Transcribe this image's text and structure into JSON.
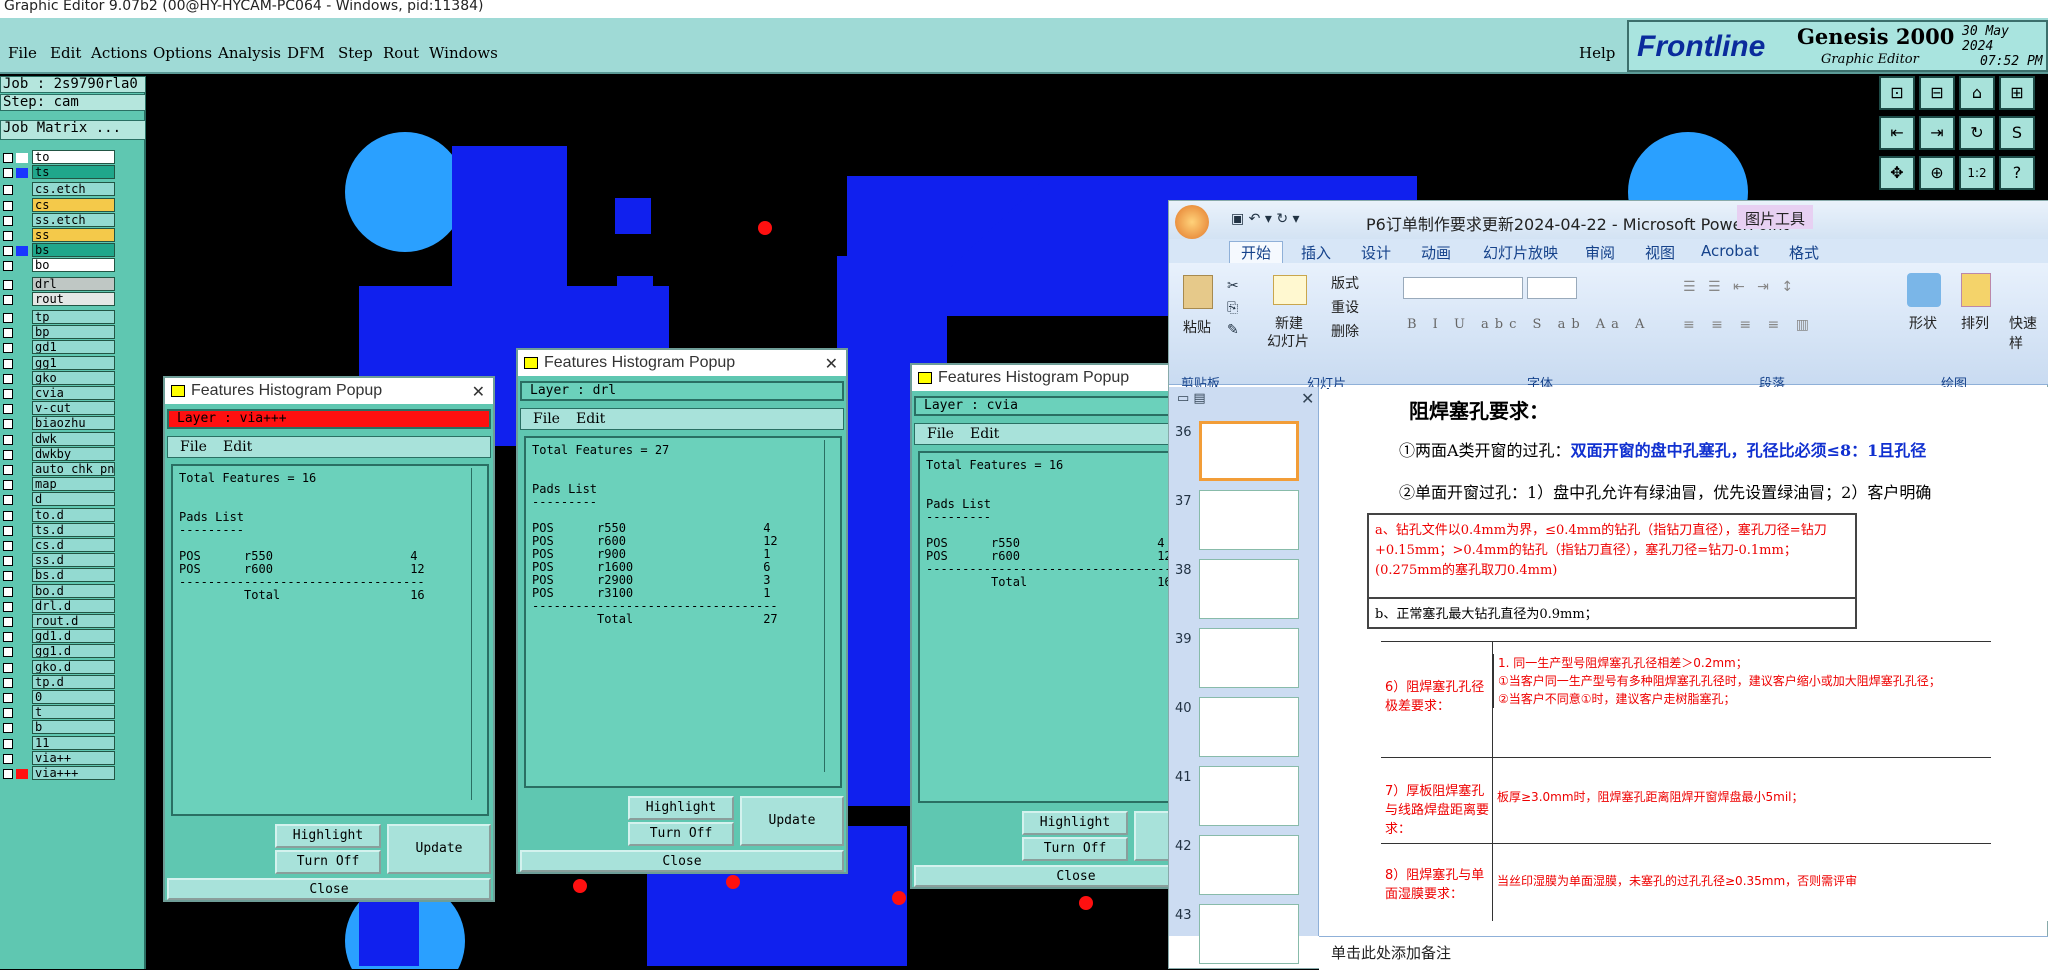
{
  "window": {
    "title": "Graphic Editor 9.07b2 (00@HY-HYCAM-PC064 - Windows, pid:11384)"
  },
  "menubar": {
    "items": [
      "File",
      "Edit",
      "Actions",
      "Options",
      "Analysis",
      "DFM",
      "Step",
      "Rout",
      "Windows"
    ],
    "help": "Help"
  },
  "brand": {
    "logo": "Frontline",
    "product": "Genesis 2000",
    "subtitle": "Graphic Editor",
    "date": "30 May 2024",
    "time": "07:52 PM"
  },
  "job": {
    "job": "Job : 2s9790rla0",
    "step": "Step: cam",
    "matrix": "Job Matrix ..."
  },
  "layers": [
    {
      "name": "to",
      "swatch": "#ffffff",
      "bg": "#ffffff"
    },
    {
      "name": "ts",
      "swatch": "#1a36ff",
      "bg": "#20a78b"
    },
    {
      "name": "cs.etch",
      "swatch": "",
      "bg": "#93dad1"
    },
    {
      "name": "cs",
      "swatch": "",
      "bg": "#f4c94a"
    },
    {
      "name": "ss.etch",
      "swatch": "",
      "bg": "#93dad1"
    },
    {
      "name": "ss",
      "swatch": "",
      "bg": "#f4c94a"
    },
    {
      "name": "bs",
      "swatch": "#1a36ff",
      "bg": "#20a78b"
    },
    {
      "name": "bo",
      "swatch": "",
      "bg": "#ffffff"
    },
    {
      "name": "drl",
      "swatch": "",
      "bg": "#bfc7c4"
    },
    {
      "name": "rout",
      "swatch": "",
      "bg": "#e3e7e5"
    },
    {
      "name": "tp",
      "swatch": "",
      "bg": "#93dad1"
    },
    {
      "name": "bp",
      "swatch": "",
      "bg": "#93dad1"
    },
    {
      "name": "gd1",
      "swatch": "",
      "bg": "#93dad1"
    },
    {
      "name": "gg1",
      "swatch": "",
      "bg": "#93dad1"
    },
    {
      "name": "gko",
      "swatch": "",
      "bg": "#93dad1"
    },
    {
      "name": "cvia",
      "swatch": "",
      "bg": "#93dad1"
    },
    {
      "name": "v-cut",
      "swatch": "",
      "bg": "#93dad1"
    },
    {
      "name": "biaozhu",
      "swatch": "",
      "bg": "#93dad1"
    },
    {
      "name": "dwk",
      "swatch": "",
      "bg": "#93dad1"
    },
    {
      "name": "dwkby",
      "swatch": "",
      "bg": "#93dad1"
    },
    {
      "name": "auto_chk_pn",
      "swatch": "",
      "bg": "#93dad1"
    },
    {
      "name": "map",
      "swatch": "",
      "bg": "#93dad1"
    },
    {
      "name": "d",
      "swatch": "",
      "bg": "#93dad1"
    },
    {
      "name": "to.d",
      "swatch": "",
      "bg": "#93dad1"
    },
    {
      "name": "ts.d",
      "swatch": "",
      "bg": "#93dad1"
    },
    {
      "name": "cs.d",
      "swatch": "",
      "bg": "#93dad1"
    },
    {
      "name": "ss.d",
      "swatch": "",
      "bg": "#93dad1"
    },
    {
      "name": "bs.d",
      "swatch": "",
      "bg": "#93dad1"
    },
    {
      "name": "bo.d",
      "swatch": "",
      "bg": "#93dad1"
    },
    {
      "name": "drl.d",
      "swatch": "",
      "bg": "#93dad1"
    },
    {
      "name": "rout.d",
      "swatch": "",
      "bg": "#93dad1"
    },
    {
      "name": "gd1.d",
      "swatch": "",
      "bg": "#93dad1"
    },
    {
      "name": "gg1.d",
      "swatch": "",
      "bg": "#93dad1"
    },
    {
      "name": "gko.d",
      "swatch": "",
      "bg": "#93dad1"
    },
    {
      "name": "tp.d",
      "swatch": "",
      "bg": "#93dad1"
    },
    {
      "name": "0",
      "swatch": "",
      "bg": "#93dad1"
    },
    {
      "name": "t",
      "swatch": "",
      "bg": "#93dad1"
    },
    {
      "name": "b",
      "swatch": "",
      "bg": "#93dad1"
    },
    {
      "name": "11",
      "swatch": "",
      "bg": "#93dad1"
    },
    {
      "name": "via++",
      "swatch": "",
      "bg": "#93dad1"
    },
    {
      "name": "via+++",
      "swatch": "#ff1010",
      "bg": "#93dad1"
    }
  ],
  "popups": [
    {
      "title": "Features Histogram Popup",
      "layer": "Layer :  via+++",
      "menu_file": "File",
      "menu_edit": "Edit",
      "text": "Total Features = 16\n\n\nPads List\n---------\n\nPOS      r550                   4\nPOS      r600                   12\n----------------------------------\n         Total                  16",
      "highlight": "Highlight",
      "turnoff": "Turn Off",
      "update": "Update",
      "close": "Close"
    },
    {
      "title": "Features Histogram Popup",
      "layer": "Layer :  drl",
      "menu_file": "File",
      "menu_edit": "Edit",
      "text": "Total Features = 27\n\n\nPads List\n---------\n\nPOS      r550                   4\nPOS      r600                   12\nPOS      r900                   1\nPOS      r1600                  6\nPOS      r2900                  3\nPOS      r3100                  1\n----------------------------------\n         Total                  27",
      "highlight": "Highlight",
      "turnoff": "Turn Off",
      "update": "Update",
      "close": "Close"
    },
    {
      "title": "Features Histogram Popup",
      "layer": "Layer :  cvia",
      "menu_file": "File",
      "menu_edit": "Edit",
      "text": "Total Features = 16\n\n\nPads List\n---------\n\nPOS      r550                   4\nPOS      r600                   12\n----------------------------------\n         Total                  16",
      "highlight": "Highlight",
      "turnoff": "Turn Off",
      "update": "U",
      "close": "Close"
    }
  ],
  "ppt": {
    "title": "P6订单制作要求更新2024-04-22 - Microsoft PowerPoint",
    "tooltab": "图片工具",
    "tabs": [
      "开始",
      "插入",
      "设计",
      "动画",
      "幻灯片放映",
      "审阅",
      "视图",
      "Acrobat",
      "格式"
    ],
    "ribbon": {
      "paste": "粘贴",
      "newslide1": "新建",
      "newslide2": "幻灯片",
      "layout": "版式",
      "reset": "重设",
      "delete": "删除",
      "shape": "形状",
      "arrange": "排列",
      "quick": "快速样",
      "groups": [
        "剪贴板",
        "幻灯片",
        "字体",
        "段落",
        "绘图"
      ]
    },
    "thumbs": [
      "36",
      "37",
      "38",
      "39",
      "40",
      "41",
      "42",
      "43"
    ],
    "slide": {
      "heading": "阻焊塞孔要求：",
      "line1": "①两面A类开窗的过孔：",
      "line1b": "双面开窗的盘中孔塞孔，孔径比必须≤8：1且孔径",
      "line2": "②单面开窗过孔：1）盘中孔允许有绿油冒，优先设置绿油冒；2）客户明确",
      "box_a": "a、钻孔文件以0.4mm为界，≤0.4mm的钻孔（指钻刀直径），塞孔刀径=钻刀+0.15mm；>0.4mm的钻孔（指钻刀直径），塞孔刀径=钻刀-0.1mm；(0.275mm的塞孔取刀0.4mm)",
      "box_b": "b、正常塞孔最大钻孔直径为0.9mm；",
      "rows": [
        {
          "label": "6）阻焊塞孔孔径极差要求：",
          "text": "1. 同一生产型号阻焊塞孔孔径相差＞0.2mm；\n①当客户同一生产型号有多种阻焊塞孔孔径时，建议客户缩小或加大阻焊塞孔孔径；\n②当客户不同意①时，建议客户走树脂塞孔；"
        },
        {
          "label": "7）厚板阻焊塞孔与线路焊盘距离要求：",
          "text": "板厚≥3.0mm时，阻焊塞孔距离阻焊开窗焊盘最小5mil；"
        },
        {
          "label": "8）阻焊塞孔与单面湿膜要求：",
          "text": "当丝印湿膜为单面湿膜，未塞孔的过孔孔径≥0.35mm，否则需评审"
        }
      ]
    },
    "notes": "单击此处添加备注"
  }
}
